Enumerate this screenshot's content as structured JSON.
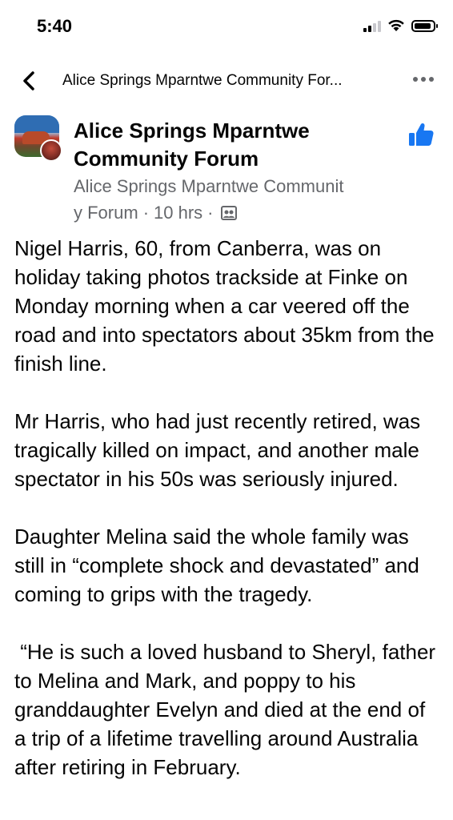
{
  "status_bar": {
    "time": "5:40"
  },
  "nav": {
    "title": "Alice Springs Mparntwe Community For..."
  },
  "post": {
    "page_name": "Alice Springs Mparntwe Community Forum",
    "author_line": "Alice Springs Mparntwe Communit",
    "author_line_cont": "y Forum",
    "time_ago": "10 hrs",
    "separator": "·",
    "paragraphs": [
      "Nigel Harris, 60, from Canberra, was on holiday taking photos trackside at Finke on Monday morning when a car veered off the road and into spectators about 35km from the finish line.",
      "Mr Harris, who had just recently retired, was tragically killed on impact, and another male spectator in his 50s was seriously injured.",
      "Daughter Melina said the whole family was still in “complete shock and devastated” and coming to grips with the tragedy.",
      " “He is such a loved husband to Sheryl, father to Melina and Mark, and poppy to his granddaughter Evelyn and died at the end of a trip of a lifetime travelling around Australia after retiring in February."
    ]
  },
  "icons": {
    "back": "chevron-left-icon",
    "more": "more-horizontal-icon",
    "like": "thumbs-up-icon",
    "audience": "group-audience-icon"
  },
  "colors": {
    "accent": "#1877f2",
    "secondary_text": "#65676b"
  }
}
